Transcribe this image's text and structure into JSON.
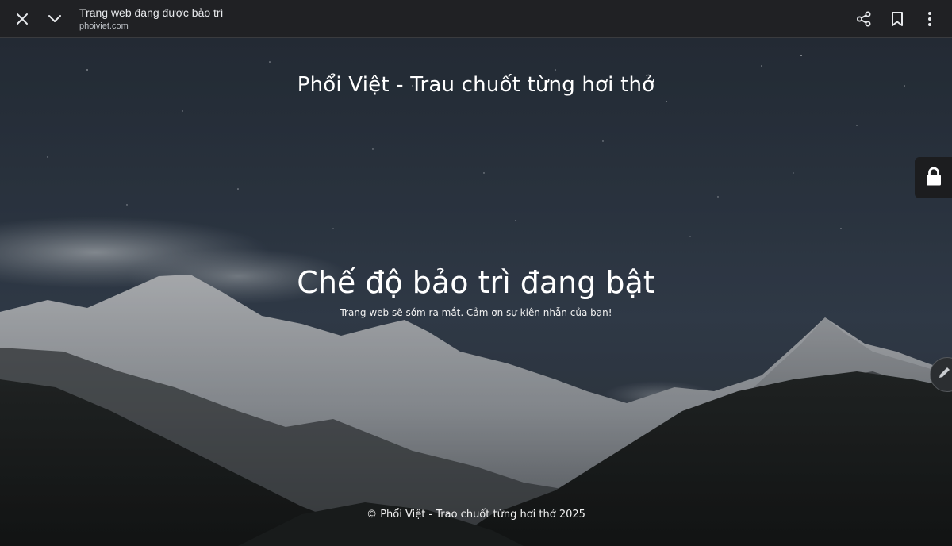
{
  "browser": {
    "page_title": "Trang web đang được bảo trì",
    "url": "phoiviet.com",
    "icons": {
      "close": "close-icon",
      "collapse": "chevron-down-icon",
      "share": "share-icon",
      "bookmark": "bookmark-icon",
      "menu": "more-vert-icon"
    }
  },
  "page": {
    "site_title": "Phổi Việt - Trau chuốt từng hơi thở",
    "heading": "Chế độ bảo trì đang bật",
    "subheading": "Trang web sẽ sớm ra mắt. Cảm ơn sự kiên nhẫn của bạn!",
    "footer": "© Phổi Việt - Trao chuốt từng hơi thở 2025",
    "side_icons": {
      "lock": "lock-icon",
      "edit": "pencil-icon"
    }
  },
  "colors": {
    "toolbar_bg": "#202124",
    "text": "#ffffff",
    "sky": "#323d4b"
  }
}
